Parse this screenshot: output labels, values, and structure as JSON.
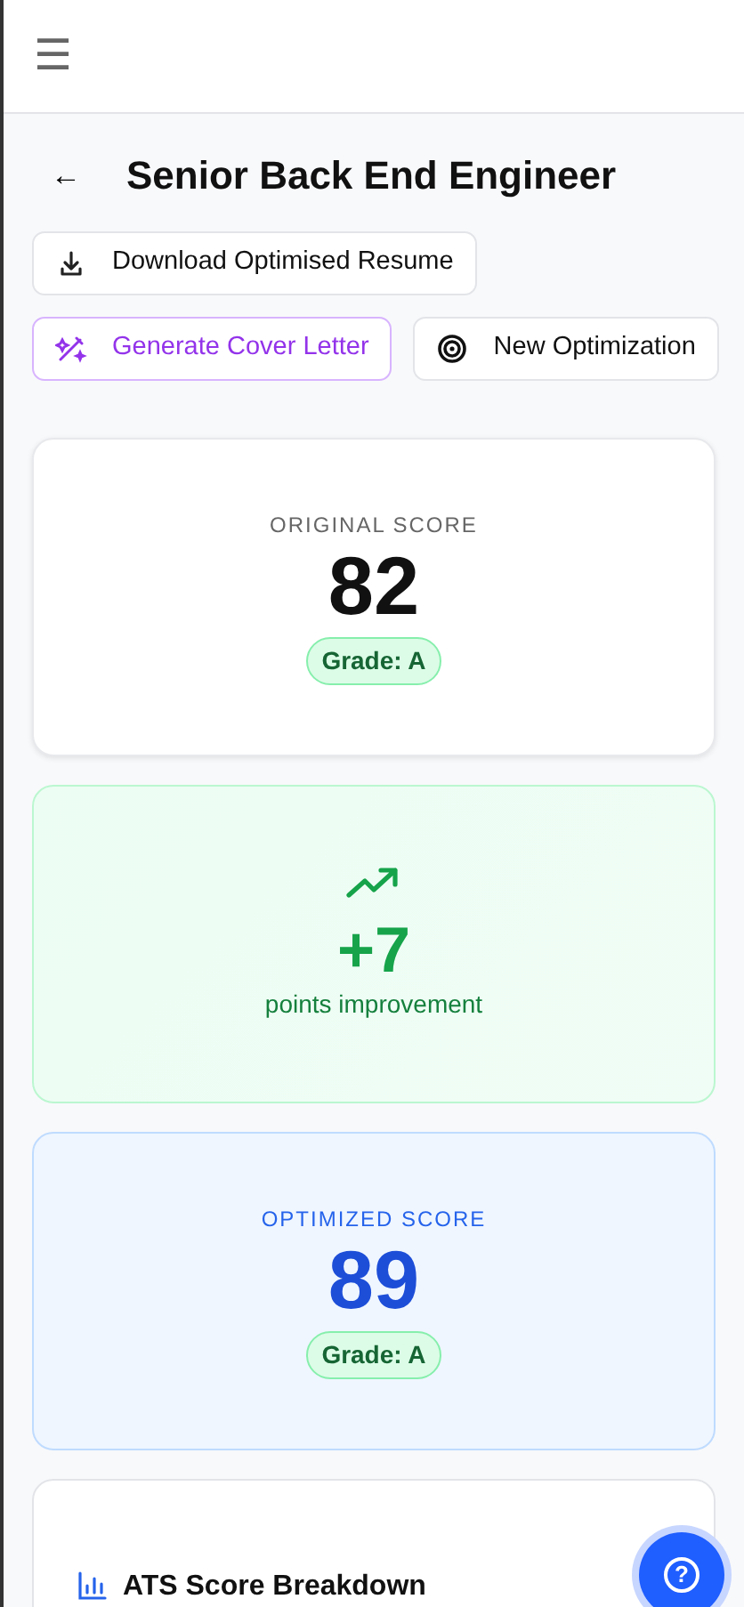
{
  "header": {
    "menu": "☰"
  },
  "page": {
    "back": "←",
    "title": "Senior Back End Engineer"
  },
  "actions": [
    {
      "kind": "download",
      "label": "Download Optimised Resume"
    },
    {
      "kind": "generate",
      "label": "Generate Cover Letter"
    },
    {
      "kind": "new",
      "label": "New Optimization"
    }
  ],
  "score_cards": [
    {
      "kind": "original",
      "label": "ORIGINAL SCORE",
      "value": "82",
      "grade": "Grade: A"
    },
    {
      "kind": "improvement",
      "value": "+7",
      "caption": "points improvement"
    },
    {
      "kind": "optimized",
      "label": "OPTIMIZED SCORE",
      "value": "89",
      "grade": "Grade: A"
    }
  ],
  "breakdown": {
    "title": "ATS Score Breakdown"
  },
  "help_button": {
    "label": "?"
  }
}
